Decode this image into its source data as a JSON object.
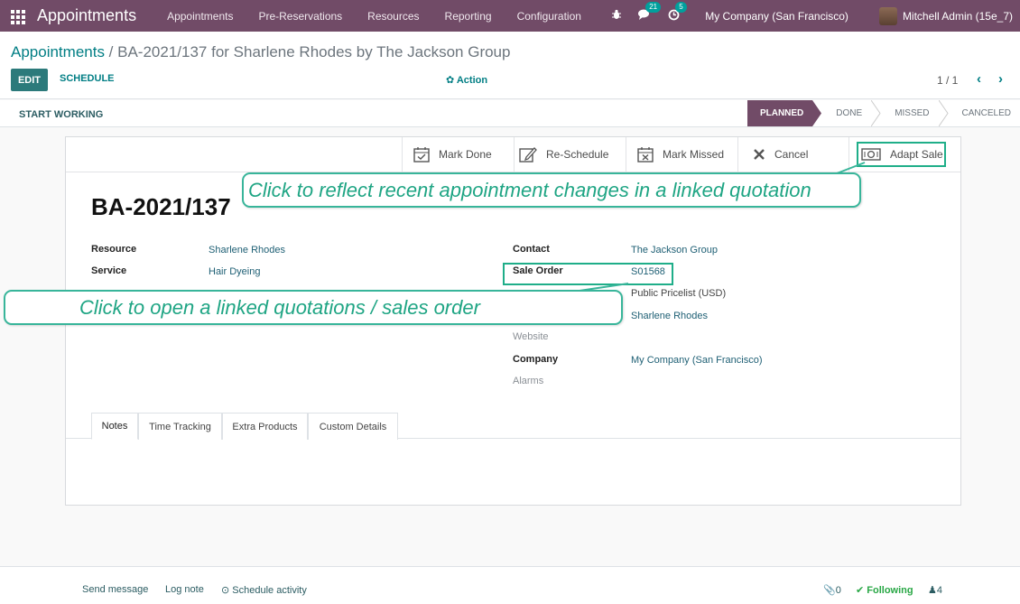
{
  "navbar": {
    "brand": "Appointments",
    "menu": [
      "Appointments",
      "Pre-Reservations",
      "Resources",
      "Reporting",
      "Configuration"
    ],
    "messages_count": "21",
    "activities_count": "5",
    "company": "My Company (San Francisco)",
    "user": "Mitchell Admin (15e_7)"
  },
  "control_panel": {
    "breadcrumb_parent": "Appointments",
    "breadcrumb_sep": " / ",
    "breadcrumb_current": "BA-2021/137 for Sharlene Rhodes by The Jackson Group",
    "edit_label": "EDIT",
    "schedule_label": "SCHEDULE",
    "action_label": "✿ Action",
    "pager": "1 / 1"
  },
  "statusbar": {
    "start_working_label": "START WORKING",
    "stages": [
      "PLANNED",
      "DONE",
      "MISSED",
      "CANCELED"
    ],
    "active_stage": "PLANNED"
  },
  "smart_buttons": {
    "mark_done": "Mark Done",
    "reschedule": "Re-Schedule",
    "mark_missed": "Mark Missed",
    "cancel": "Cancel",
    "adapt_sale": "Adapt Sale"
  },
  "record": {
    "title": "BA-2021/137",
    "resource_label": "Resource",
    "resource_value": "Sharlene Rhodes",
    "service_label": "Service",
    "service_value": "Hair Dyeing",
    "contact_label": "Contact",
    "contact_value": "The Jackson Group",
    "sale_order_label": "Sale Order",
    "sale_order_value": "S01568",
    "pricelist_value": "Public Pricelist (USD)",
    "person_value": "Sharlene Rhodes",
    "website_label": "Website",
    "company_label": "Company",
    "company_value": "My Company (San Francisco)",
    "alarms_label": "Alarms"
  },
  "tabs": [
    "Notes",
    "Time Tracking",
    "Extra Products",
    "Custom Details"
  ],
  "callouts": {
    "adapt_sale": "Click to reflect recent appointment changes in a linked quotation",
    "sale_order": "Click to open a linked quotations / sales order"
  },
  "chatter": {
    "send_message": "Send message",
    "log_note": "Log note",
    "schedule_activity": "⊙ Schedule activity",
    "attachments_count": "0",
    "following": "✔ Following",
    "followers_count": "4"
  },
  "colors": {
    "navbar": "#714b67",
    "primary_button": "#2c7a7b",
    "link": "#017e84",
    "highlight": "#1fae89"
  }
}
